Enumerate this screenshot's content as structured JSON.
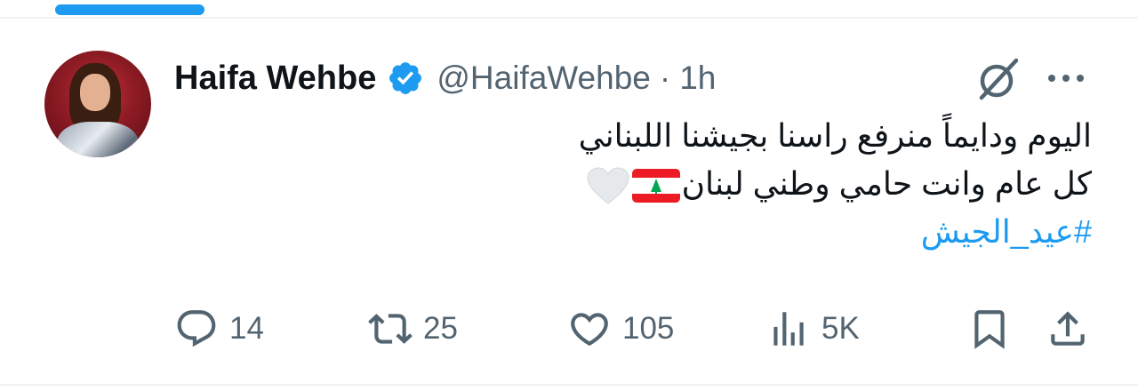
{
  "author": {
    "name": "Haifa Wehbe",
    "handle": "@HaifaWehbe",
    "separator": "·",
    "time": "1h",
    "verified": true
  },
  "tweet": {
    "line1": "اليوم ودايماً منرفع راسنا بجيشنا اللبناني",
    "line2": "كل عام وانت حامي وطني لبنان",
    "emojis": [
      "lebanon-flag",
      "white-heart"
    ],
    "hashtag": "#عيد_الجيش"
  },
  "actions": {
    "replies": "14",
    "retweets": "25",
    "likes": "105",
    "views": "5K"
  },
  "colors": {
    "accent": "#1d9bf0",
    "text": "#0f1419",
    "secondary": "#536471"
  }
}
